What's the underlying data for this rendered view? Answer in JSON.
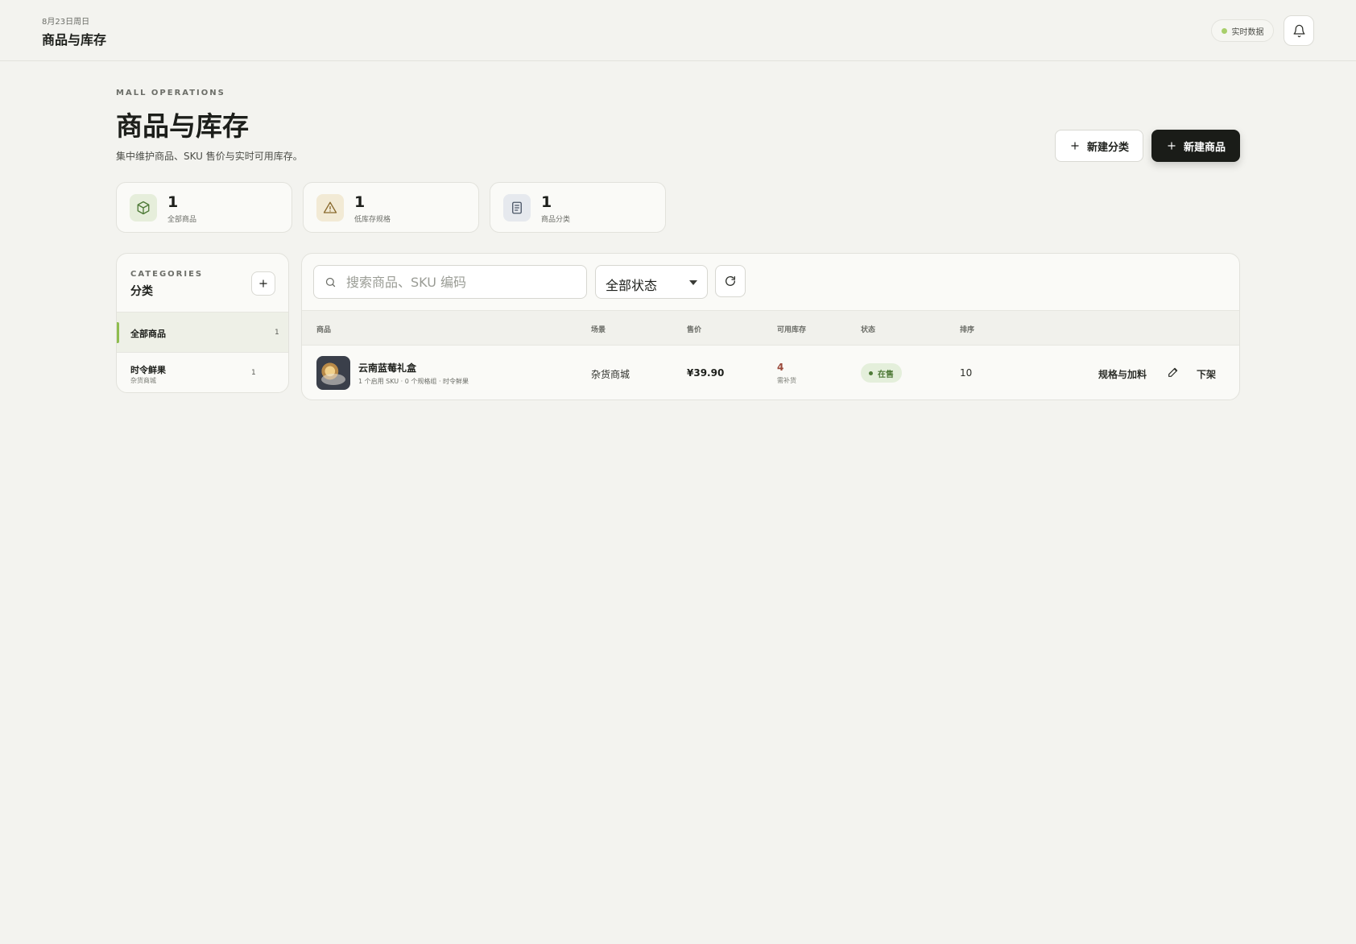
{
  "topbar": {
    "date": "8月23日周日",
    "title": "商品与库存",
    "live_label": "实时数据"
  },
  "colors": {
    "background": "#f3f3ef",
    "accent": "#8fbd4f",
    "primary_button": "#1a1c18",
    "status_on_sale": "#4e7a37",
    "low_stock": "#9b4a3b"
  },
  "header": {
    "eyebrow": "MALL OPERATIONS",
    "title": "商品与库存",
    "description": "集中维护商品、SKU 售价与实时可用库存。",
    "new_category_label": "新建分类",
    "new_product_label": "新建商品"
  },
  "stats": [
    {
      "icon": "box-icon",
      "value": "1",
      "label": "全部商品"
    },
    {
      "icon": "warning-icon",
      "value": "1",
      "label": "低库存规格"
    },
    {
      "icon": "document-icon",
      "value": "1",
      "label": "商品分类"
    }
  ],
  "categories": {
    "eyebrow": "CATEGORIES",
    "title": "分类",
    "items": [
      {
        "name": "全部商品",
        "sub": "",
        "count": "1",
        "active": true
      },
      {
        "name": "时令鲜果",
        "sub": "杂货商城",
        "count": "1",
        "active": false
      }
    ]
  },
  "filters": {
    "search_placeholder": "搜索商品、SKU 编码",
    "search_value": "",
    "status_value": "全部状态"
  },
  "table": {
    "columns": [
      "商品",
      "场景",
      "售价",
      "可用库存",
      "状态",
      "排序"
    ],
    "rows": [
      {
        "name": "云南蓝莓礼盒",
        "meta": "1 个启用 SKU · 0 个规格组 · 时令鲜果",
        "scene": "杂货商城",
        "price": "¥39.90",
        "stock": "4",
        "stock_note": "需补货",
        "status": "在售",
        "sort": "10",
        "action_spec": "规格与加料",
        "action_off": "下架"
      }
    ]
  }
}
